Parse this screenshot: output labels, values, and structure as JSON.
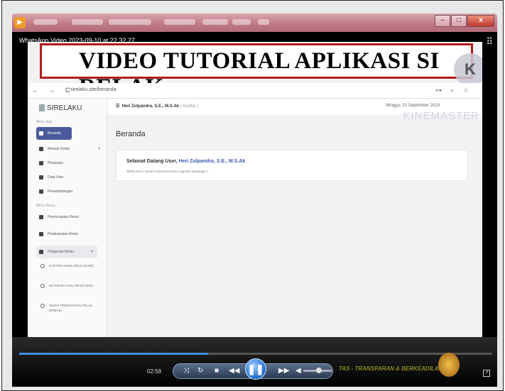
{
  "window": {
    "app_icon": "media-player-icon",
    "controls": {
      "minimize": "–",
      "maximize": "□",
      "close": "x"
    }
  },
  "player": {
    "video_filename": "WhatsApp Video 2023-09-10 at 22.32.27",
    "corner_icon": "⠿",
    "elapsed_time": "02:58",
    "progress_fraction": 0.4,
    "volume_fraction": 0.55,
    "ticker_text": "TAS - TRANSPARAN & BERKEADILAN"
  },
  "video": {
    "banner_title": "VIDEO TUTORIAL APLIKASI SI RELAK",
    "watermark": "KINEMASTER",
    "logo_letter": "K",
    "browser": {
      "url": "sirelaku.site/beranda"
    },
    "app": {
      "brand": "SIRELAKU",
      "section_main": "Menu App",
      "section_reviu": "Menu Reviu",
      "menu": [
        {
          "label": "Beranda"
        },
        {
          "label": "Manual Guide"
        },
        {
          "label": "Peraturan"
        },
        {
          "label": "Data User"
        },
        {
          "label": "Penandatangan"
        }
      ],
      "reviu_menu": [
        {
          "label": "Perencanaan Reviu"
        },
        {
          "label": "Pelaksanaan Reviu"
        },
        {
          "label": "Pelaporan Reviu"
        }
      ],
      "sub_items": [
        {
          "label": "CATATAN HASIL REVIU (CHR)"
        },
        {
          "label": "IKHTISAR HASIL REVIU (IHR)"
        },
        {
          "label": "SURAT PERNYATAAN TELAH DIREVIU"
        }
      ],
      "user_name": "Heri Zulpandra, S.E., M.S.Ak",
      "user_role": "( Auditor )",
      "date": "Minggu, 10 September 2023",
      "page_title": "Beranda",
      "welcome_prefix": "Selamat Datang User,",
      "welcome_user": "Heri Zulpandra, S.E., M.S.Ak",
      "welcome_sub": "SIRELAKU ( Sistem Informasi Reviu Laporan Keuangan )"
    }
  }
}
